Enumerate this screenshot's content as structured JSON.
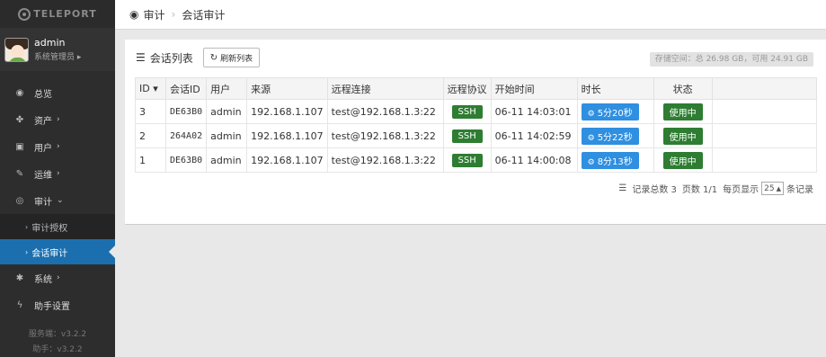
{
  "app": {
    "logo_text": "TELEPORT"
  },
  "user": {
    "name": "admin",
    "role": "系统管理员",
    "role_chev": "▸"
  },
  "sidebar": {
    "items": [
      {
        "label": "总览",
        "icon": "dashboard-icon",
        "glyph": "◉"
      },
      {
        "label": "资产",
        "icon": "cubes-icon",
        "glyph": "✤",
        "chev": "›"
      },
      {
        "label": "用户",
        "icon": "user-card-icon",
        "glyph": "▣",
        "chev": "›"
      },
      {
        "label": "运维",
        "icon": "wrench-icon",
        "glyph": "✎",
        "chev": "›"
      },
      {
        "label": "审计",
        "icon": "eye-icon",
        "glyph": "◎",
        "chev": "⌄"
      }
    ],
    "subitems": [
      {
        "label": "审计授权",
        "arrow": "›"
      },
      {
        "label": "会话审计",
        "arrow": "›"
      }
    ],
    "items2": [
      {
        "label": "系统",
        "icon": "gears-icon",
        "glyph": "✱",
        "chev": "›"
      },
      {
        "label": "助手设置",
        "icon": "bolt-icon",
        "glyph": "ϟ"
      }
    ],
    "server_version": "服务端：v3.2.2",
    "helper_version": "助手：v3.2.2"
  },
  "breadcrumb": {
    "icon": "eye-icon",
    "section": "审计",
    "separator": "›",
    "page": "会话审计"
  },
  "panel": {
    "title": "会话列表",
    "refresh_label": "刷新列表",
    "storage": "存储空间：总 26.98 GB，可用 24.91 GB"
  },
  "table": {
    "headers": [
      "ID",
      "会话ID",
      "用户",
      "来源",
      "远程连接",
      "远程协议",
      "开始时间",
      "时长",
      "状态"
    ],
    "sort_arrow": "▾",
    "rows": [
      {
        "id": "3",
        "sid": "DE63B0",
        "user": "admin",
        "source": "192.168.1.107",
        "remote": "test@192.168.1.3:22",
        "protocol": "SSH",
        "start": "06-11 14:03:01",
        "duration": "5分20秒",
        "status": "使用中"
      },
      {
        "id": "2",
        "sid": "264A02",
        "user": "admin",
        "source": "192.168.1.107",
        "remote": "test@192.168.1.3:22",
        "protocol": "SSH",
        "start": "06-11 14:02:59",
        "duration": "5分22秒",
        "status": "使用中"
      },
      {
        "id": "1",
        "sid": "DE63B0",
        "user": "admin",
        "source": "192.168.1.107",
        "remote": "test@192.168.1.3:22",
        "protocol": "SSH",
        "start": "06-11 14:00:08",
        "duration": "8分13秒",
        "status": "使用中"
      }
    ]
  },
  "pager": {
    "total": "记录总数 3",
    "pages": "页数 1/1",
    "per_page_label": "每页显示",
    "per_page": "25",
    "per_page_suffix": "条记录"
  },
  "colors": {
    "accent": "#1b6fae",
    "ssh_green": "#2e7d32",
    "duration_blue": "#2f8fe0"
  }
}
